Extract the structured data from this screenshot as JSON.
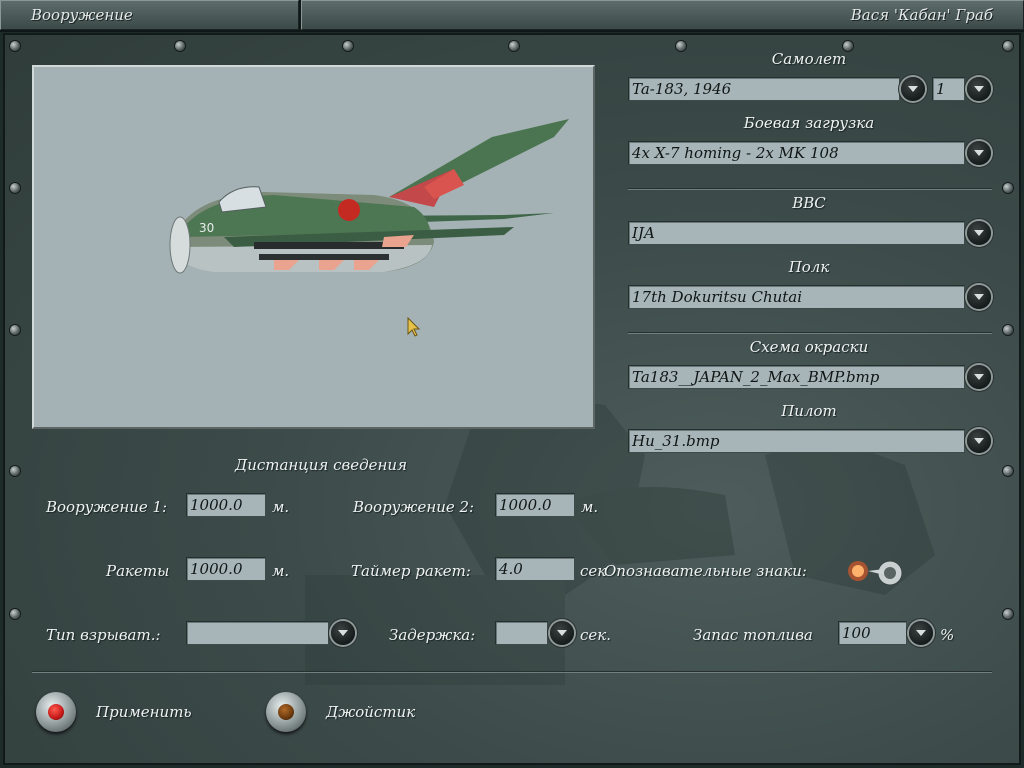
{
  "header": {
    "title": "Вооружение",
    "pilot_name": "Вася 'Кабан' Граб"
  },
  "aircraft": {
    "section_label": "Самолет",
    "value": "Ta-183, 1946",
    "count": "1",
    "marking_number": "30"
  },
  "loadout": {
    "section_label": "Боевая загрузка",
    "value": "4x X-7 homing - 2x MK 108"
  },
  "air_force": {
    "section_label": "ВВС",
    "value": "IJA"
  },
  "regiment": {
    "section_label": "Полк",
    "value": "17th Dokuritsu Chutai"
  },
  "paint_scheme": {
    "section_label": "Схема окраски",
    "value": "Ta183__JAPAN_2_Max_BMP.bmp"
  },
  "pilot_skin": {
    "section_label": "Пилот",
    "value": "Hu_31.bmp"
  },
  "convergence": {
    "heading": "Дистанция сведения",
    "weapon1_label": "Вооружение 1:",
    "weapon1_value": "1000.0",
    "weapon1_unit": "м.",
    "weapon2_label": "Вооружение 2:",
    "weapon2_value": "1000.0",
    "weapon2_unit": "м.",
    "rockets_label": "Ракеты",
    "rockets_value": "1000.0",
    "rockets_unit": "м.",
    "rocket_timer_label": "Таймер ракет:",
    "rocket_timer_value": "4.0",
    "rocket_timer_unit": "сек"
  },
  "markings": {
    "label": "Опознавательные знаки:",
    "enabled": true
  },
  "fuse": {
    "type_label": "Тип взрыват.:",
    "type_value": "",
    "delay_label": "Задержка:",
    "delay_value": "",
    "delay_unit": "сек."
  },
  "fuel": {
    "label": "Запас топлива",
    "value": "100",
    "unit": "%"
  },
  "buttons": {
    "apply_label": "Применить",
    "joystick_label": "Джойстик"
  },
  "colors": {
    "panel": "#3c4b49",
    "field_bg": "#a8b5b8",
    "preview_bg": "#a4b2b5",
    "apply_led": "#c31818",
    "joystick_led": "#6a3a0e",
    "toggle_glow": "#ff5a1e"
  },
  "icons": {
    "dropdown": "chevron-down-icon",
    "rivet": "rivet-icon",
    "cursor": "mouse-cursor-icon"
  }
}
